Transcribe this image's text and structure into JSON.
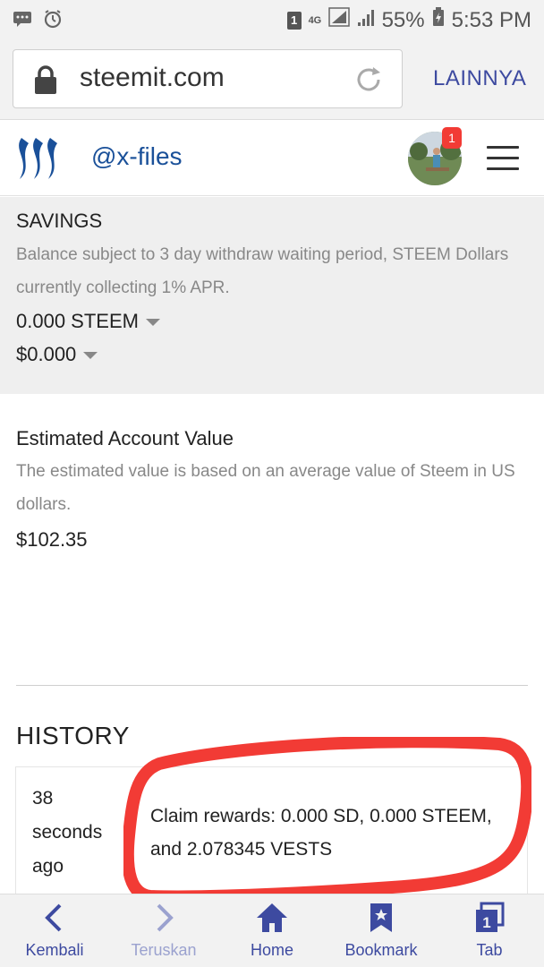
{
  "status_bar": {
    "sim": "1",
    "network": "4G",
    "battery": "55%",
    "time": "5:53 PM"
  },
  "browser": {
    "url": "steemit.com",
    "menu_label": "LAINNYA"
  },
  "header": {
    "username": "@x-files",
    "notification_count": "1"
  },
  "savings": {
    "title": "SAVINGS",
    "description": "Balance subject to 3 day withdraw waiting period, STEEM Dollars currently collecting 1% APR.",
    "steem_amount": "0.000 STEEM",
    "sbd_amount": "$0.000"
  },
  "estimated": {
    "title": "Estimated Account Value",
    "description": "The estimated value is based on an average value of Steem in US dollars.",
    "value": "$102.35"
  },
  "history": {
    "title": "HISTORY",
    "rows": [
      {
        "time": "38 seconds ago",
        "operation": "Claim rewards: 0.000 SD, 0.000 STEEM, and 2.078345 VESTS"
      }
    ]
  },
  "bottom_nav": {
    "items": [
      {
        "label": "Kembali",
        "icon": "chevron-left-icon",
        "enabled": true
      },
      {
        "label": "Teruskan",
        "icon": "chevron-right-icon",
        "enabled": false
      },
      {
        "label": "Home",
        "icon": "home-icon",
        "enabled": true
      },
      {
        "label": "Bookmark",
        "icon": "bookmark-icon",
        "enabled": true
      },
      {
        "label": "Tab",
        "icon": "tabs-icon",
        "enabled": true
      }
    ]
  },
  "colors": {
    "accent": "#3d4aa0",
    "username": "#1a5099",
    "annotation": "#f23b35",
    "section_bg": "#efefef"
  }
}
